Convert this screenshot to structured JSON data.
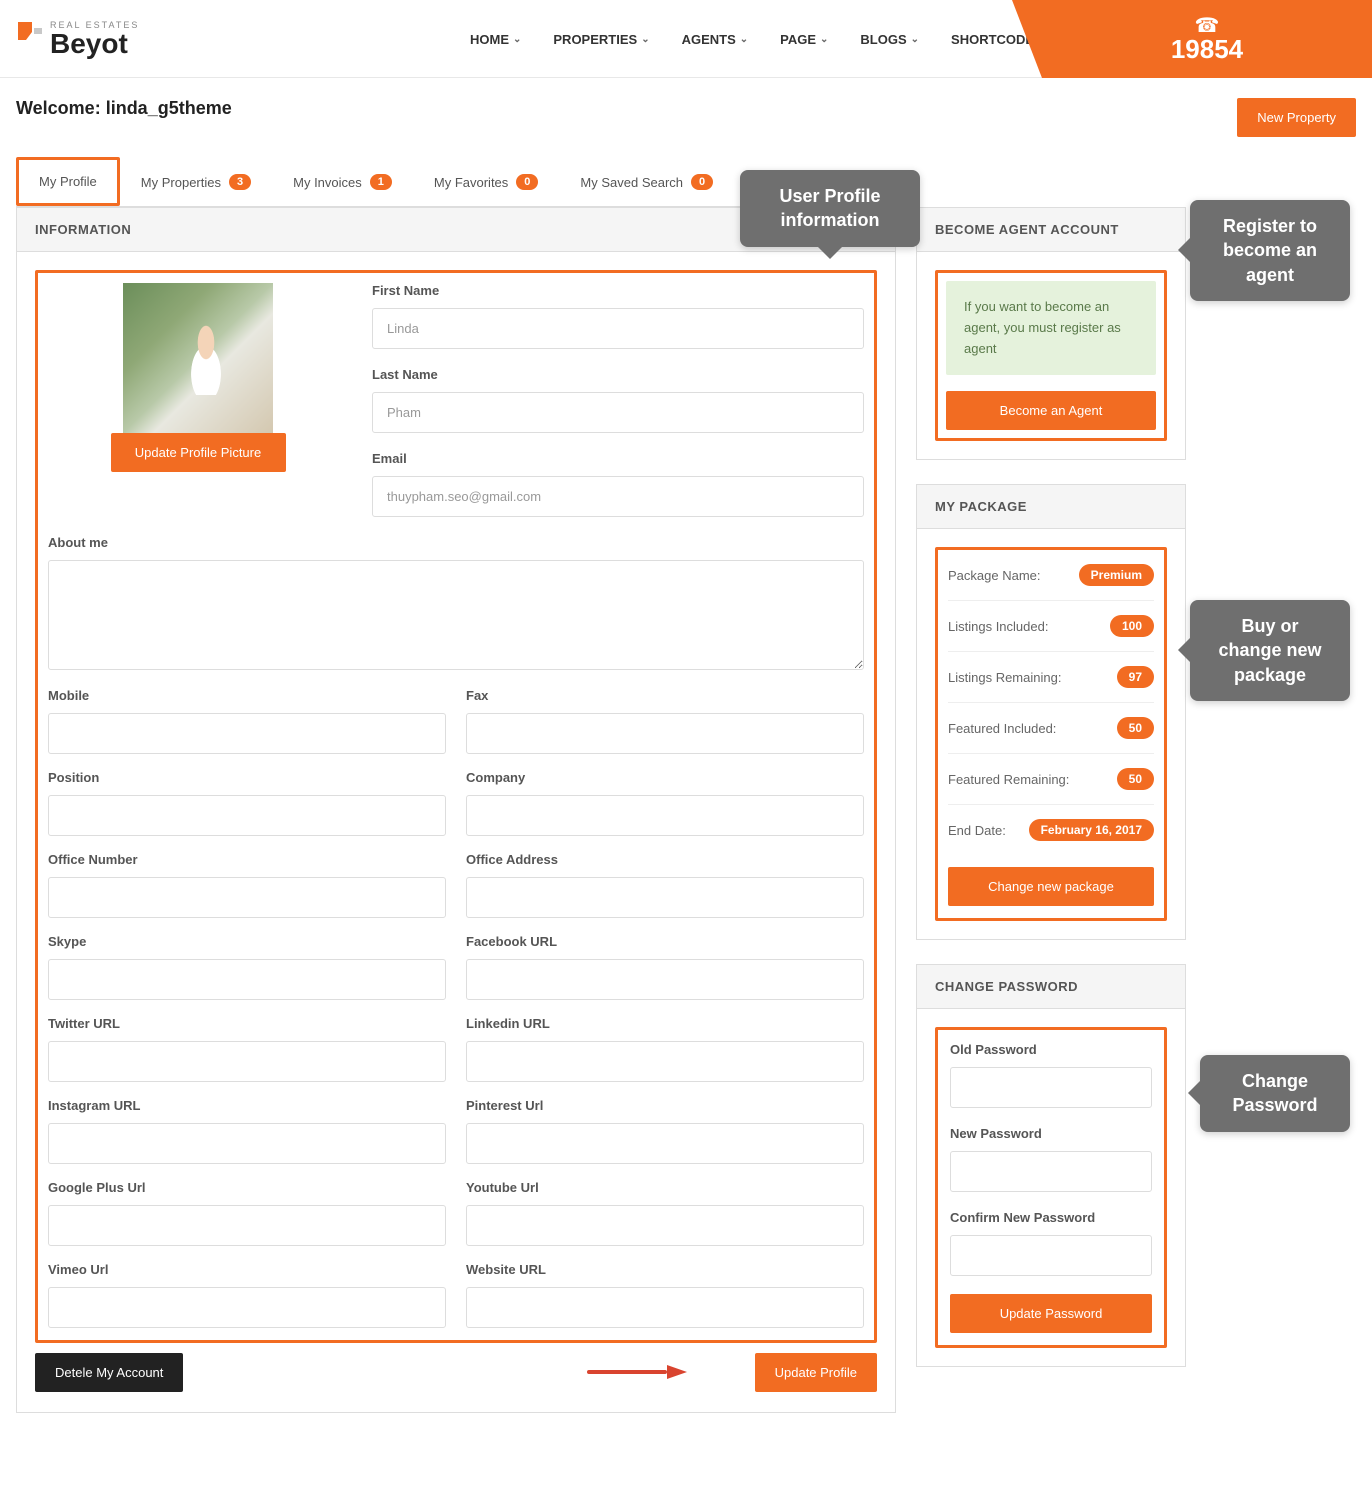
{
  "header": {
    "logo_small": "REAL ESTATES",
    "logo_big": "Beyot",
    "nav": [
      {
        "label": "HOME"
      },
      {
        "label": "PROPERTIES"
      },
      {
        "label": "AGENTS"
      },
      {
        "label": "PAGE"
      },
      {
        "label": "BLOGS"
      },
      {
        "label": "SHORTCODE"
      }
    ],
    "phone": "19854"
  },
  "page": {
    "welcome": "Welcome: linda_g5theme",
    "new_property": "New Property"
  },
  "tabs": [
    {
      "label": "My Profile",
      "count": null,
      "active": true
    },
    {
      "label": "My Properties",
      "count": "3",
      "active": false
    },
    {
      "label": "My Invoices",
      "count": "1",
      "active": false
    },
    {
      "label": "My Favorites",
      "count": "0",
      "active": false
    },
    {
      "label": "My Saved Search",
      "count": "0",
      "active": false
    }
  ],
  "info_panel": {
    "title": "INFORMATION",
    "update_picture": "Update Profile Picture",
    "fields": {
      "first_name": {
        "label": "First Name",
        "value": "Linda"
      },
      "last_name": {
        "label": "Last Name",
        "value": "Pham"
      },
      "email": {
        "label": "Email",
        "value": "thuypham.seo@gmail.com"
      },
      "about": {
        "label": "About me"
      },
      "mobile": {
        "label": "Mobile"
      },
      "fax": {
        "label": "Fax"
      },
      "position": {
        "label": "Position"
      },
      "company": {
        "label": "Company"
      },
      "office_number": {
        "label": "Office Number"
      },
      "office_address": {
        "label": "Office Address"
      },
      "skype": {
        "label": "Skype"
      },
      "facebook": {
        "label": "Facebook URL"
      },
      "twitter": {
        "label": "Twitter URL"
      },
      "linkedin": {
        "label": "Linkedin URL"
      },
      "instagram": {
        "label": "Instagram URL"
      },
      "pinterest": {
        "label": "Pinterest Url"
      },
      "googleplus": {
        "label": "Google Plus Url"
      },
      "youtube": {
        "label": "Youtube Url"
      },
      "vimeo": {
        "label": "Vimeo Url"
      },
      "website": {
        "label": "Website URL"
      }
    },
    "delete_btn": "Detele My Account",
    "update_btn": "Update Profile"
  },
  "agent_panel": {
    "title": "BECOME AGENT ACCOUNT",
    "alert": "If you want to become an agent, you must register as agent",
    "button": "Become an Agent"
  },
  "package_panel": {
    "title": "MY PACKAGE",
    "rows": [
      {
        "label": "Package Name:",
        "value": "Premium"
      },
      {
        "label": "Listings Included:",
        "value": "100"
      },
      {
        "label": "Listings Remaining:",
        "value": "97"
      },
      {
        "label": "Featured Included:",
        "value": "50"
      },
      {
        "label": "Featured Remaining:",
        "value": "50"
      },
      {
        "label": "End Date:",
        "value": "February 16, 2017"
      }
    ],
    "button": "Change new package"
  },
  "password_panel": {
    "title": "CHANGE PASSWORD",
    "old": "Old Password",
    "new": "New Password",
    "confirm": "Confirm New Password",
    "button": "Update Password"
  },
  "callouts": {
    "profile": "User Profile information",
    "agent": "Register to become an agent",
    "package": "Buy or change new package",
    "password": "Change Password"
  }
}
